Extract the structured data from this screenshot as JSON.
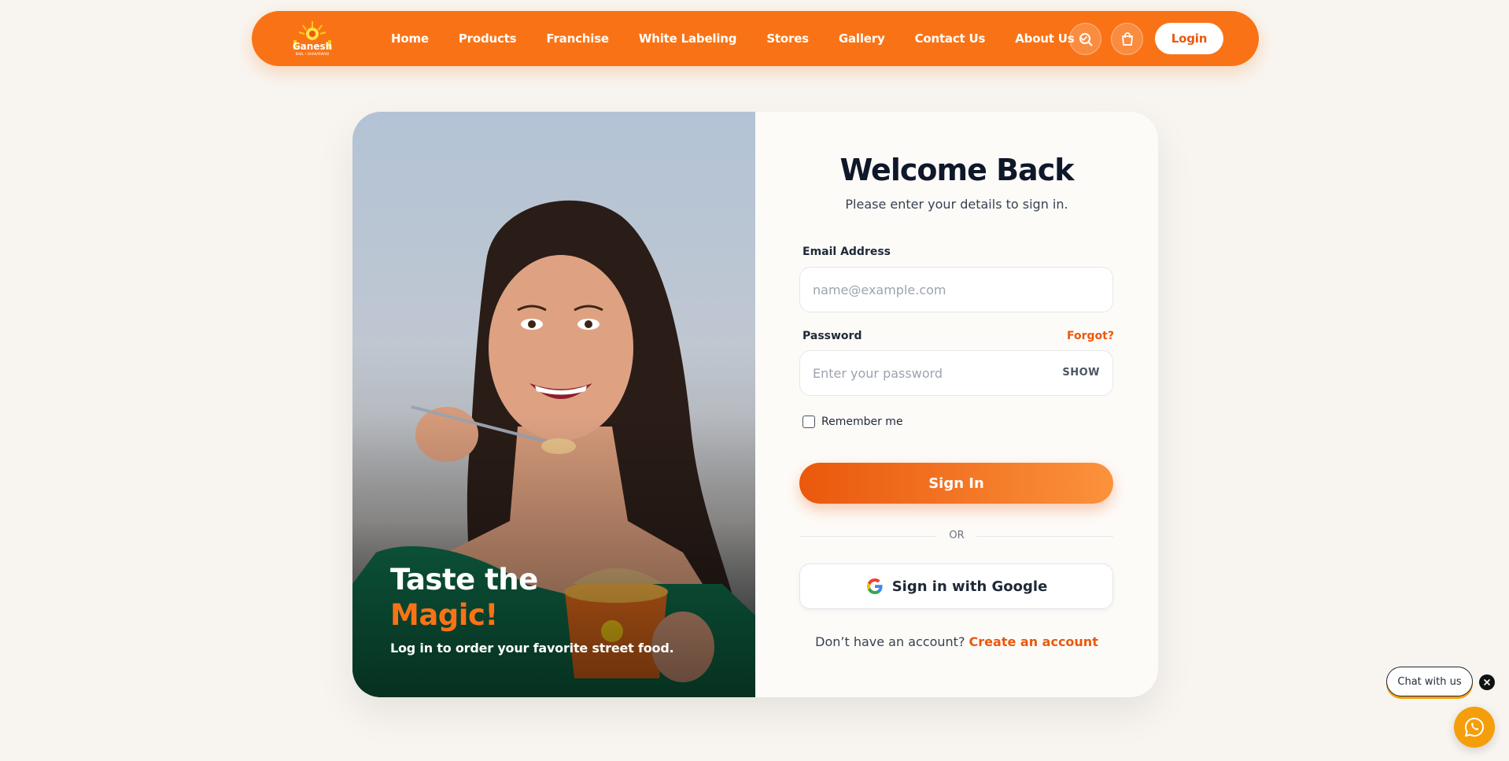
{
  "brand": {
    "name": "Ganesh",
    "tagline": "BHEL • BHAKARWADI",
    "accent_color": "#f97316"
  },
  "nav": {
    "links": [
      "Home",
      "Products",
      "Franchise",
      "White Labeling",
      "Stores",
      "Gallery",
      "Contact Us",
      "About Us"
    ],
    "about_dropdown_icon": "chevron-down-icon",
    "search_icon": "search-icon",
    "cart_icon": "shopping-bag-icon",
    "login_label": "Login"
  },
  "hero": {
    "title_line1": "Taste the",
    "title_line2": "Magic!",
    "subtitle": "Log in to order your favorite street food."
  },
  "form": {
    "title": "Welcome Back",
    "subtitle": "Please enter your details to sign in.",
    "email_label": "Email Address",
    "email_placeholder": "name@example.com",
    "password_label": "Password",
    "forgot_label": "Forgot?",
    "password_placeholder": "Enter your password",
    "show_label": "SHOW",
    "remember_label": "Remember me",
    "signin_label": "Sign In",
    "or_label": "OR",
    "google_label": "Sign in with Google",
    "signup_prompt": "Don’t have an account?",
    "signup_link": "Create an account"
  },
  "chat": {
    "label": "Chat with us",
    "close_icon": "close-icon",
    "whatsapp_icon": "whatsapp-icon"
  }
}
